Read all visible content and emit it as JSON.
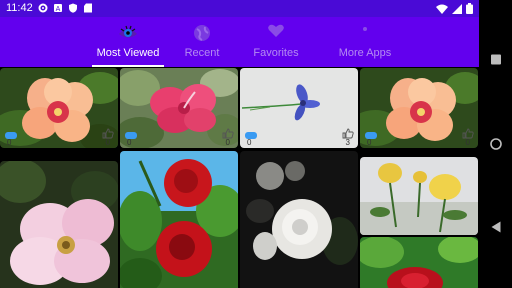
{
  "status": {
    "time": "11:42"
  },
  "tabs": [
    {
      "label": "Most Viewed",
      "active": true,
      "icon": "eye-icon"
    },
    {
      "label": "Recent",
      "active": false,
      "icon": "globe-icon"
    },
    {
      "label": "Favorites",
      "active": false,
      "icon": "heart-icon"
    },
    {
      "label": "More Apps",
      "active": false,
      "icon": "apps-icon"
    }
  ],
  "photos": [
    {
      "subject": "peach-hibiscus",
      "views": "0",
      "likes": "0"
    },
    {
      "subject": "pink-hibiscus",
      "views": "0",
      "likes": "0"
    },
    {
      "subject": "blue-flower",
      "views": "0",
      "likes": "3"
    },
    {
      "subject": "peach-hibiscus-2",
      "views": "0",
      "likes": "0"
    },
    {
      "subject": "pink-wild-rose"
    },
    {
      "subject": "red-roses"
    },
    {
      "subject": "white-roses"
    },
    {
      "subject": "yellow-roses"
    },
    {
      "subject": "red-flowers"
    }
  ],
  "colors": {
    "statusbar": "#4a0ad6",
    "tabbar": "#6200ee",
    "accent": "#ffffff"
  }
}
